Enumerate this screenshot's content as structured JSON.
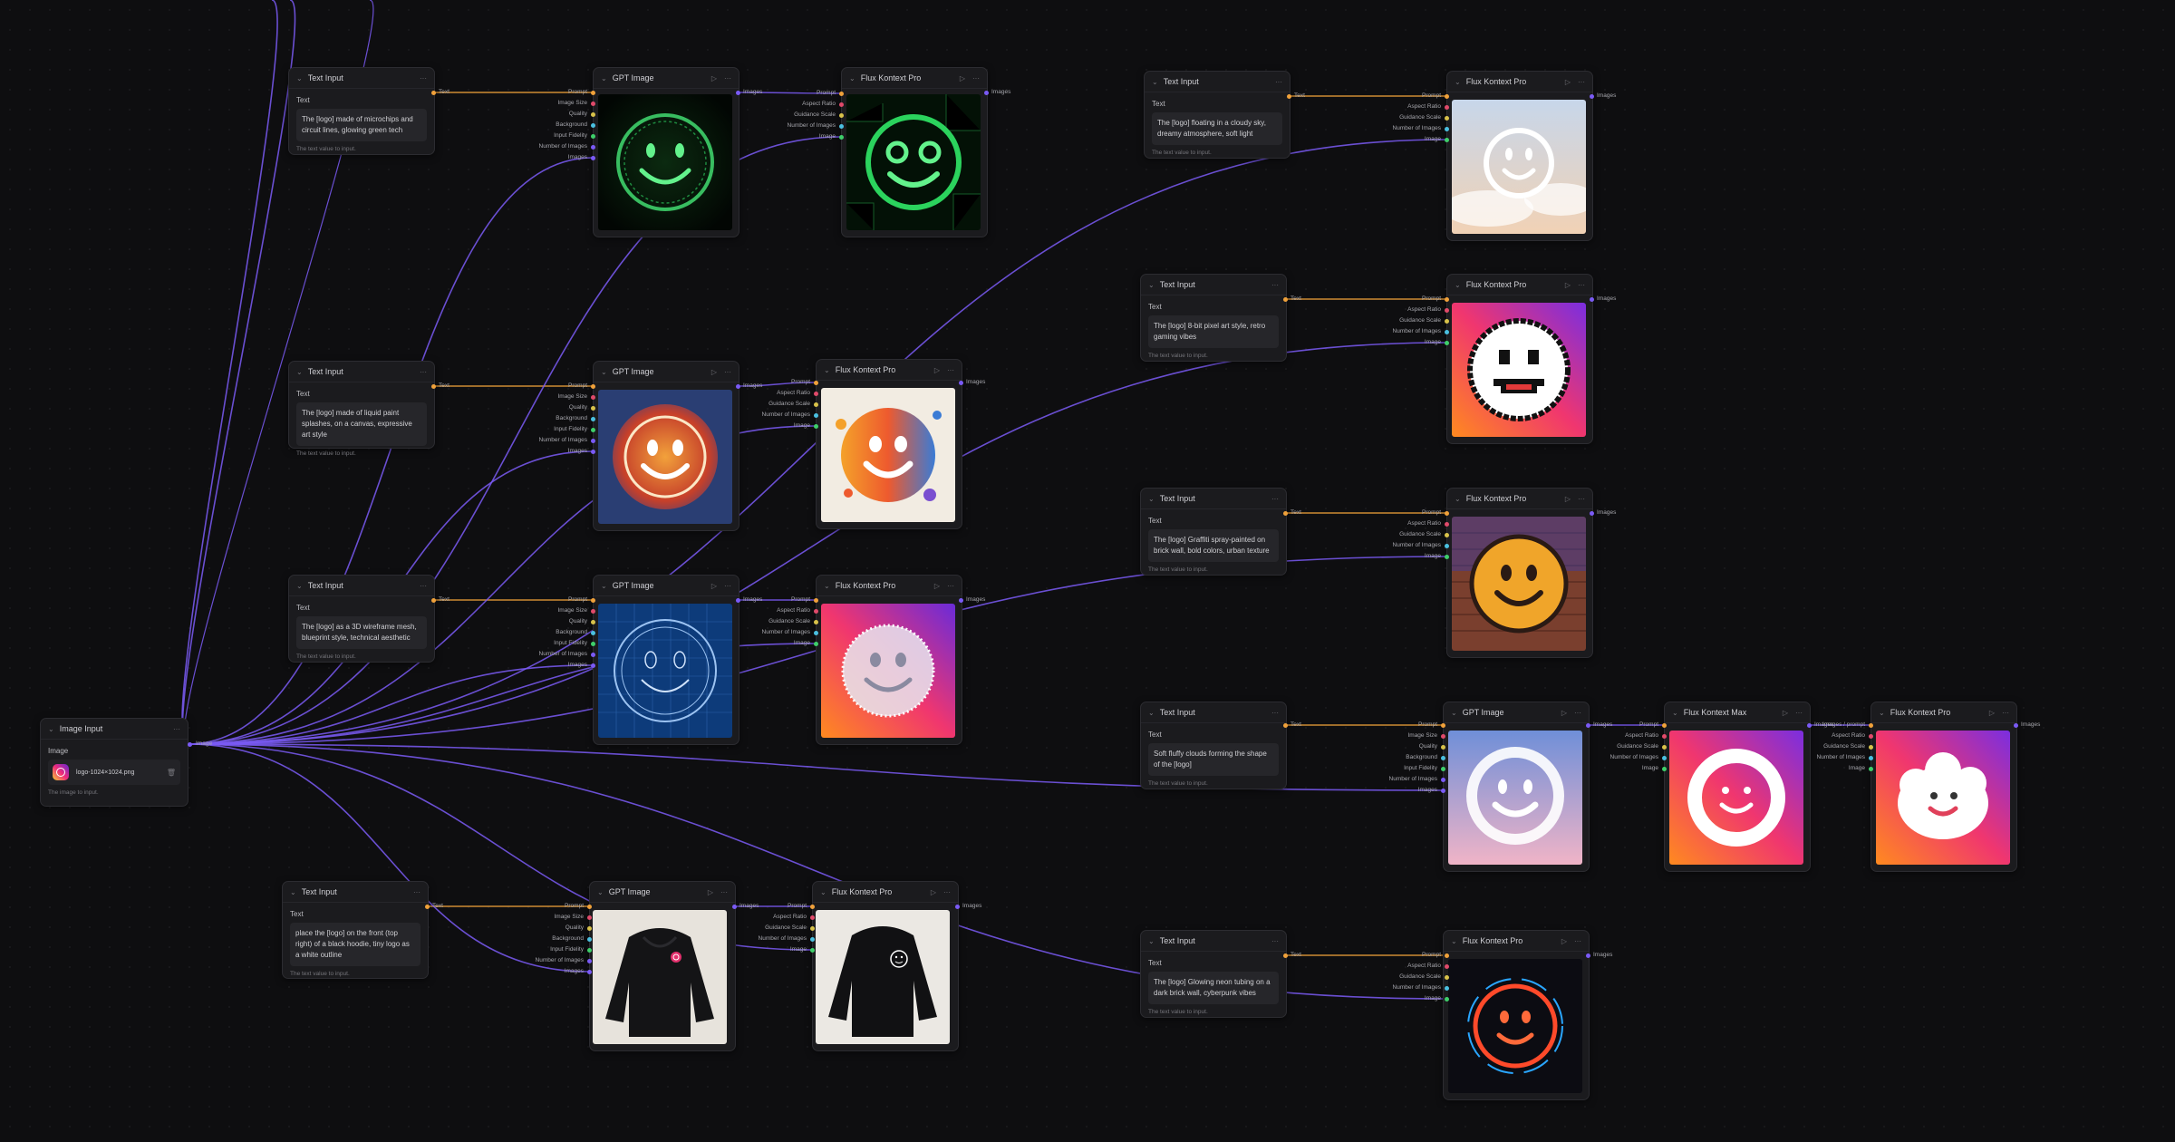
{
  "labels": {
    "text_input": "Text Input",
    "text": "Text",
    "help_text": "The text value to input.",
    "gpt_image": "GPT Image",
    "flux_pro": "Flux Kontext Pro",
    "flux_max": "Flux Kontext Max",
    "image_input": "Image Input",
    "image": "Image",
    "image_help": "The image to input."
  },
  "file_name": "logo-1024×1024.png",
  "gpt_inputs": [
    "Prompt",
    "Image Size",
    "Quality",
    "Background",
    "Input Fidelity",
    "Number of Images",
    "Images"
  ],
  "flux_inputs": [
    "Prompt",
    "Aspect Ratio",
    "Guidance Scale",
    "Number of Images",
    "Image"
  ],
  "flux_max_inputs": [
    "Images / prompt",
    "Aspect Ratio",
    "Guidance Scale",
    "Number of Images",
    "Image"
  ],
  "port_labels": {
    "text_out": "Text",
    "images_out": "Images",
    "image_out": "Image"
  },
  "prompts": [
    "The [logo] made of microchips and circuit lines, glowing green tech",
    "The [logo] made of liquid paint splashes, on a canvas, expressive art style",
    "The [logo] as a 3D wireframe mesh, blueprint style, technical aesthetic",
    "place the [logo] on the front (top right) of a black hoodie, tiny logo as a white outline",
    "The [logo] floating in a cloudy sky, dreamy atmosphere, soft light",
    "The [logo] 8-bit pixel art style, retro gaming vibes",
    "The [logo] Graffiti spray-painted on brick wall, bold colors, urban texture",
    "Soft fluffy clouds forming the shape of the [logo]",
    "The [logo] Glowing neon tubing on a dark brick wall, cyberpunk vibes"
  ],
  "colors": {
    "wire_text": "#f0a13a",
    "wire_image": "#7a5af5",
    "accent_green": "#3ecf6a"
  },
  "icons": [
    "chevron-down-icon",
    "play-icon",
    "more-icon",
    "trash-icon",
    "instagram-icon"
  ]
}
